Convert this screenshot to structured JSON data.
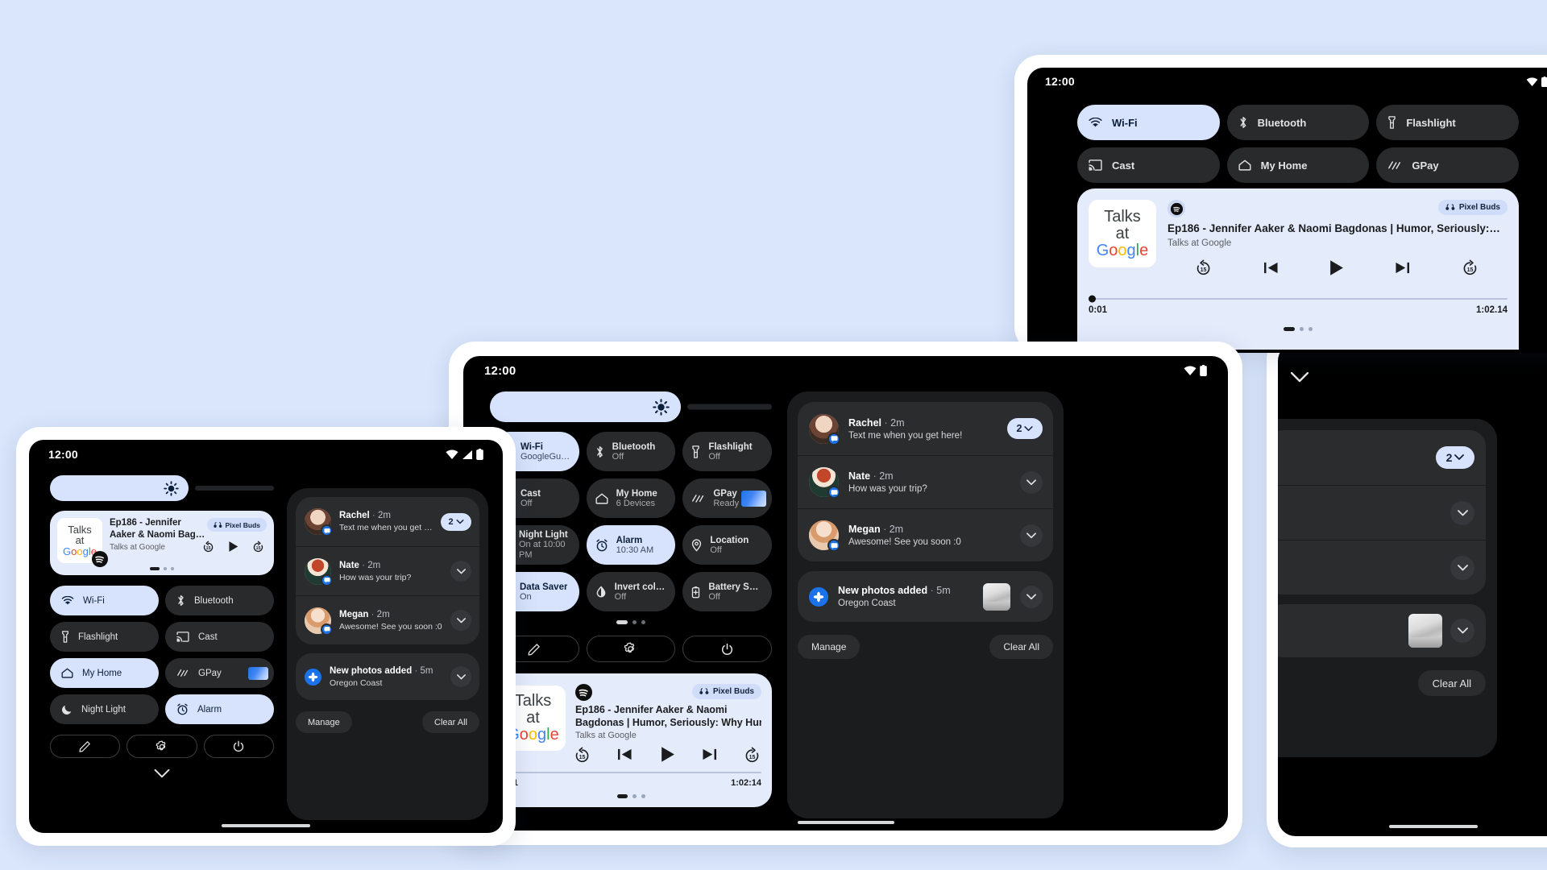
{
  "background_color": "#d9e6fb",
  "status_bar": {
    "time": "12:00",
    "icons": [
      "wifi-icon",
      "battery-icon"
    ]
  },
  "brightness": {
    "name": "brightness-slider",
    "icon": "brightness-icon"
  },
  "media": {
    "art_lines": [
      "Talks",
      "at",
      "Google"
    ],
    "source_icon": "spotify-icon",
    "output_chip": {
      "icon": "earbuds-icon",
      "label": "Pixel Buds"
    },
    "title_full": "Ep186 - Jennifer Aaker & Naomi Bagdonas | Humor, Seriously:…",
    "title_tablet_line1": "Ep186 - Jennifer Aaker & Naomi",
    "title_tablet_line2": "Bagdonas | Humor, Seriously: Why Hum…",
    "title_phone_line1": "Ep186 - Jennifer",
    "title_phone_line2": "Aaker & Naomi Bag…",
    "subtitle": "Talks at Google",
    "controls": [
      "replay-15-button",
      "previous-button",
      "play-button",
      "next-button",
      "forward-15-button"
    ],
    "replay_label": "15",
    "forward_label": "15",
    "elapsed": "0:01",
    "duration_tablet": "1:02:14",
    "duration_foldable": "1:02.14",
    "page_dots": 3,
    "active_dot": 0
  },
  "notifications": {
    "items": [
      {
        "name": "Rachel",
        "time": "2m",
        "body": "Text me when you get here!",
        "trailing": "count-chip",
        "count": "2",
        "app_icon": "messages-icon"
      },
      {
        "name": "Nate",
        "time": "2m",
        "body": "How was your trip?",
        "trailing": "chevron",
        "app_icon": "messages-icon"
      },
      {
        "name": "Megan",
        "time": "2m",
        "body": "Awesome! See you soon :0",
        "trailing": "chevron",
        "app_icon": "messages-icon"
      }
    ],
    "photos": {
      "name": "New photos added",
      "time": "5m",
      "body": "Oregon Coast",
      "app_icon": "photos-icon",
      "trailing": "chevron",
      "thumbnail": "coast-photo"
    },
    "buttons": {
      "manage": "Manage",
      "clear_all": "Clear All"
    },
    "separator": "·"
  },
  "foldable_tiles": [
    {
      "label": "Wi-Fi",
      "icon": "wifi-icon",
      "on": true
    },
    {
      "label": "Bluetooth",
      "icon": "bluetooth-icon",
      "on": false
    },
    {
      "label": "Flashlight",
      "icon": "flashlight-icon",
      "on": false
    },
    {
      "label": "Cast",
      "icon": "cast-icon",
      "on": false
    },
    {
      "label": "My Home",
      "icon": "home-icon",
      "on": false
    },
    {
      "label": "GPay",
      "icon": "gpay-icon",
      "on": false
    }
  ],
  "tablet_tiles": [
    {
      "label": "Wi-Fi",
      "sub": "GoogleGuest",
      "icon": "wifi-icon",
      "on": true
    },
    {
      "label": "Bluetooth",
      "sub": "Off",
      "icon": "bluetooth-icon",
      "on": false
    },
    {
      "label": "Flashlight",
      "sub": "Off",
      "icon": "flashlight-icon",
      "on": false
    },
    {
      "label": "Cast",
      "sub": "Off",
      "icon": "cast-icon",
      "on": false
    },
    {
      "label": "My Home",
      "sub": "6 Devices",
      "icon": "home-icon",
      "on": false
    },
    {
      "label": "GPay",
      "sub": "Ready",
      "icon": "gpay-icon",
      "on": false,
      "card": true
    },
    {
      "label": "Night Light",
      "sub": "On at 10:00 PM",
      "icon": "moon-icon",
      "on": false
    },
    {
      "label": "Alarm",
      "sub": "10:30 AM",
      "icon": "alarm-icon",
      "on": true
    },
    {
      "label": "Location",
      "sub": "Off",
      "icon": "location-icon",
      "on": false
    },
    {
      "label": "Data Saver",
      "sub": "On",
      "icon": "datasaver-icon",
      "on": true
    },
    {
      "label": "Invert colors",
      "sub": "Off",
      "icon": "invert-icon",
      "on": false
    },
    {
      "label": "Battery Saver",
      "sub": "Off",
      "icon": "batterysaver-icon",
      "on": false
    }
  ],
  "phone_tiles": [
    {
      "label": "Wi-Fi",
      "icon": "wifi-icon",
      "on": true
    },
    {
      "label": "Bluetooth",
      "icon": "bluetooth-icon",
      "on": false
    },
    {
      "label": "Flashlight",
      "icon": "flashlight-icon",
      "on": false
    },
    {
      "label": "Cast",
      "icon": "cast-icon",
      "on": false
    },
    {
      "label": "My Home",
      "icon": "home-icon",
      "on": true
    },
    {
      "label": "GPay",
      "icon": "gpay-icon",
      "on": false,
      "card": true
    },
    {
      "label": "Night Light",
      "icon": "moon-icon",
      "on": false
    },
    {
      "label": "Alarm",
      "icon": "alarm-icon",
      "on": true
    }
  ],
  "footer_buttons": [
    {
      "name": "edit-tiles-button",
      "icon": "pencil-icon"
    },
    {
      "name": "settings-button",
      "icon": "gear-icon"
    },
    {
      "name": "power-button",
      "icon": "power-icon"
    }
  ],
  "collapse_icon": "chevron-down-icon",
  "tablet_page_dots": {
    "count": 3,
    "active": 0
  }
}
